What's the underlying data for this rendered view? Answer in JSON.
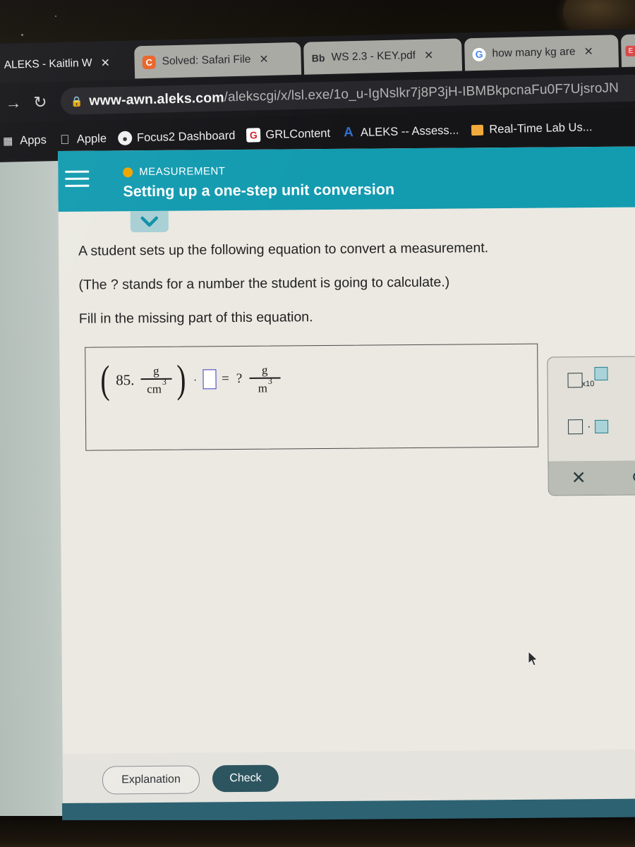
{
  "browser": {
    "tabs": [
      {
        "title": "ALEKS - Kaitlin W",
        "favicon": "aleks-icon",
        "close": "✕",
        "active": true
      },
      {
        "title": "Solved: Safari File",
        "favicon": "chegg-icon",
        "close": "✕",
        "active": false
      },
      {
        "title": "WS 2.3 - KEY.pdf",
        "favicon": "blackboard-icon",
        "close": "✕",
        "active": false
      },
      {
        "title": "how many kg are",
        "favicon": "google-icon",
        "close": "✕",
        "active": false
      }
    ],
    "nav": {
      "forward": "→",
      "reload": "↻",
      "lock": "🔒"
    },
    "url": {
      "domain": "www-awn.aleks.com",
      "path": "/alekscgi/x/lsl.exe/1o_u-IgNslkr7j8P3jH-IBMBkpcnaFu0F7UjsroJN"
    },
    "bookmarks": [
      {
        "label": "Apps",
        "icon": "apps-icon"
      },
      {
        "label": "Apple",
        "icon": "apple-icon"
      },
      {
        "label": "Focus2 Dashboard",
        "icon": "focus2-icon"
      },
      {
        "label": "GRLContent",
        "icon": "grl-icon"
      },
      {
        "label": "ALEKS -- Assess...",
        "icon": "aleks-letter-icon"
      },
      {
        "label": "Real-Time Lab Us...",
        "icon": "lab-icon"
      }
    ]
  },
  "header": {
    "menu_icon": "hamburger-menu-icon",
    "topic_label": "MEASUREMENT",
    "topic_dot_color": "#f0a500",
    "title": "Setting up a one-step unit conversion",
    "background_color": "#139bb0",
    "expand_icon": "chevron-down-icon"
  },
  "question": {
    "line1": "A student sets up the following equation to convert a measurement.",
    "line2": "(The ? stands for a number the student is going to calculate.)",
    "line3": "Fill in the missing part of this equation."
  },
  "equation": {
    "open_paren": "(",
    "coefficient": "85.",
    "left_fraction": {
      "numerator": "g",
      "denominator": "cm",
      "denominator_exponent": "3"
    },
    "close_paren": ")",
    "multiply": "·",
    "answer_box_placeholder": "",
    "answer_box_border_color": "#3b3bbf",
    "equals": "=",
    "question_mark": "?",
    "right_fraction": {
      "numerator": "g",
      "denominator": "m",
      "denominator_exponent": "3"
    }
  },
  "keypad": {
    "buttons": [
      {
        "name": "scientific-notation-button",
        "label": "x10"
      },
      {
        "name": "multiplication-dot-button",
        "label": "·"
      },
      {
        "name": "fraction-button",
        "label": ""
      }
    ],
    "clear_icon": "✕",
    "undo_icon": "↺"
  },
  "actions": {
    "explanation": "Explanation",
    "check": "Check",
    "check_bg": "#2d5560"
  },
  "cursor": {
    "name": "mouse-pointer"
  }
}
